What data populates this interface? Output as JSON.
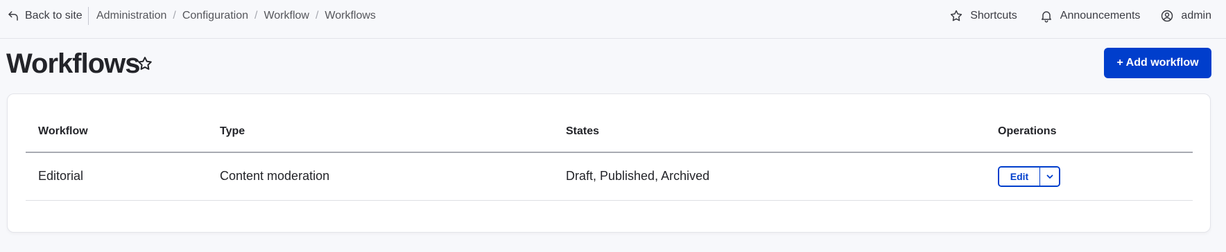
{
  "toolbar": {
    "back_label": "Back to site",
    "breadcrumb": [
      "Administration",
      "Configuration",
      "Workflow",
      "Workflows"
    ],
    "shortcuts_label": "Shortcuts",
    "announcements_label": "Announcements",
    "user_label": "admin"
  },
  "header": {
    "title": "Workflows",
    "add_button_label": "+ Add workflow"
  },
  "table": {
    "columns": [
      "Workflow",
      "Type",
      "States",
      "Operations"
    ],
    "rows": [
      {
        "workflow": "Editorial",
        "type": "Content moderation",
        "states": "Draft, Published, Archived",
        "edit_label": "Edit"
      }
    ]
  },
  "colors": {
    "accent": "#003ecc",
    "background": "#f7f8fb",
    "text": "#232429"
  },
  "icons": [
    "back-arrow-icon",
    "star-icon",
    "bell-icon",
    "user-circle-icon",
    "chevron-down-icon"
  ]
}
